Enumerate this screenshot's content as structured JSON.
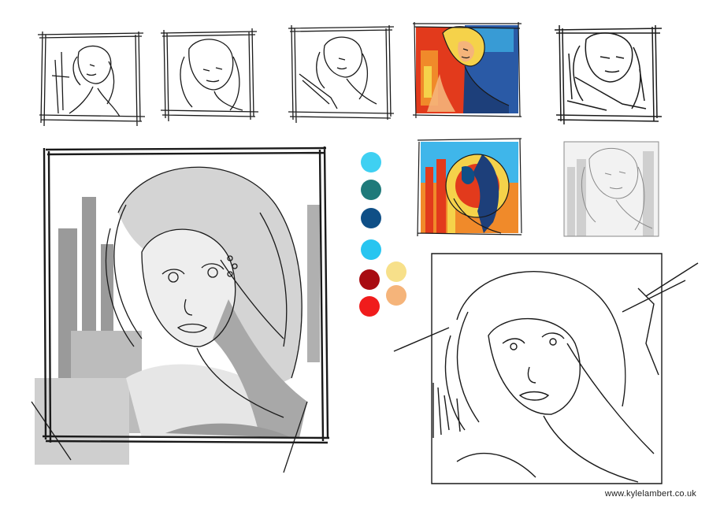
{
  "watermark": "www.kylelambert.co.uk",
  "palette": {
    "swatches": [
      {
        "name": "cyan-light",
        "color": "#3fd0f2"
      },
      {
        "name": "teal",
        "color": "#1f7a7a"
      },
      {
        "name": "navy",
        "color": "#0f4f86"
      },
      {
        "name": "cyan",
        "color": "#28c5f0"
      },
      {
        "name": "crimson",
        "color": "#a80c12"
      },
      {
        "name": "pale-yellow",
        "color": "#f7e08a"
      },
      {
        "name": "red",
        "color": "#f01c1c"
      },
      {
        "name": "peach",
        "color": "#f5b47a"
      }
    ]
  },
  "colors": {
    "ink": "#1a1a1a",
    "grey_light": "#d4d4d4",
    "grey_mid": "#9a9a9a",
    "warm_red": "#e23a1c",
    "warm_orange": "#f08a2a",
    "warm_yellow": "#f5d24a",
    "cool_blue": "#2a5aa6",
    "sky_blue": "#3fb6ea"
  }
}
